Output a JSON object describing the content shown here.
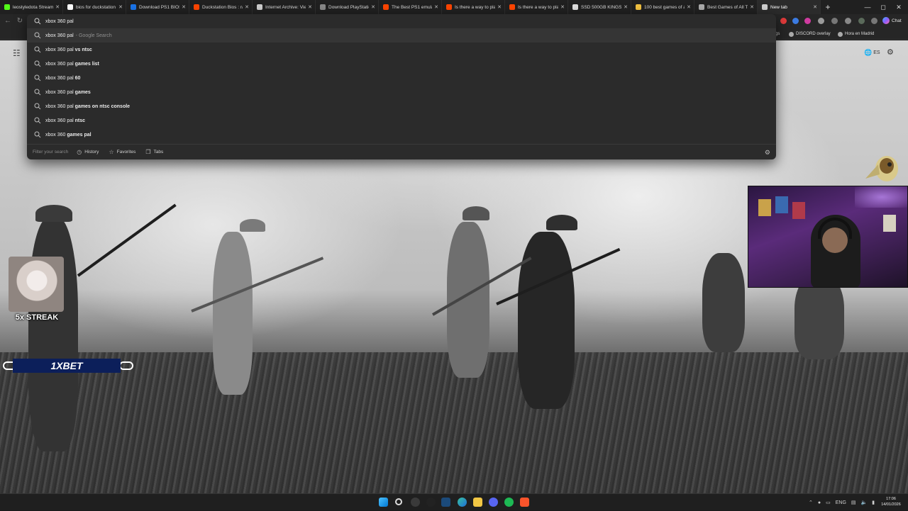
{
  "tabs": [
    {
      "title": "leostyledota Stream - ",
      "favicon_color": "#53fc18"
    },
    {
      "title": "bios for duckstation - ",
      "favicon_color": "#ffffff"
    },
    {
      "title": "Download PS1 BIOS F",
      "favicon_color": "#1a73e8"
    },
    {
      "title": "Duckstation Bios : r/Re",
      "favicon_color": "#ff4500"
    },
    {
      "title": "Internet Archive: View",
      "favicon_color": "#cccccc"
    },
    {
      "title": "Download PlayStation",
      "favicon_color": "#888888"
    },
    {
      "title": "The Best PS1 emulato",
      "favicon_color": "#ff4500"
    },
    {
      "title": "Is there a way to play",
      "favicon_color": "#ff4500"
    },
    {
      "title": "Is there a way to play",
      "favicon_color": "#ff4500"
    },
    {
      "title": "SSD 500GB KINGSTON",
      "favicon_color": "#dddddd"
    },
    {
      "title": "100 best games of all",
      "favicon_color": "#f0c040"
    },
    {
      "title": "Best Games of All Tim",
      "favicon_color": "#aaaaaa"
    },
    {
      "title": "New tab",
      "favicon_color": "#cfcfcf",
      "active": true
    }
  ],
  "omnibox": {
    "query": "xbox 360 pal",
    "suggestions": [
      {
        "prefix": "xbox 360 pal",
        "suffix": "",
        "hint": "- Google Search"
      },
      {
        "prefix": "xbox 360 pal",
        "suffix": " vs ntsc",
        "hint": ""
      },
      {
        "prefix": "xbox 360 pal",
        "suffix": " games list",
        "hint": ""
      },
      {
        "prefix": "xbox 360 pal",
        "suffix": " 60",
        "hint": ""
      },
      {
        "prefix": "xbox 360 pal",
        "suffix": " games",
        "hint": ""
      },
      {
        "prefix": "xbox 360 pal",
        "suffix": " games on ntsc console",
        "hint": ""
      },
      {
        "prefix": "xbox 360 pal",
        "suffix": " ntsc",
        "hint": ""
      },
      {
        "prefix": "xbox 360 ",
        "suffix": "games pal",
        "hint": ""
      }
    ],
    "filter_placeholder": "Filter your search",
    "footer_buttons": {
      "history": "History",
      "favorites": "Favorites",
      "tabs": "Tabs"
    }
  },
  "toolbar": {
    "chat_label": "Chat"
  },
  "favorites_bar": {
    "items": [
      {
        "label": "gs"
      },
      {
        "label": "DISCORD overlay"
      },
      {
        "label": "Hora en Madrid"
      }
    ]
  },
  "newtab": {
    "language": "ES"
  },
  "overlays": {
    "streak_label": "5x STREAK",
    "bet_logo": "1XBET"
  },
  "taskbar": {
    "lang": "ENG",
    "time": "17:06",
    "date": "14/01/2026"
  },
  "colors": {
    "tab_bg": "#202020",
    "omnibox_bg": "#2b2b2b",
    "bet_blue": "#0c1f5a",
    "webcam_purple": "#5a2b7a"
  }
}
